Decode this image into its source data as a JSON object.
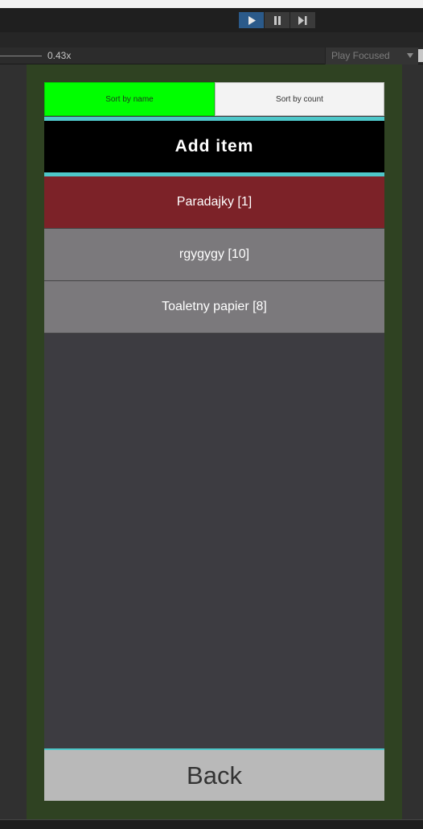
{
  "toolbar": {
    "play_icon": "play-icon",
    "pause_icon": "pause-icon",
    "step_icon": "step-icon"
  },
  "game_view": {
    "scale_label": "0.43x",
    "play_mode_label": "Play Focused"
  },
  "app": {
    "sort_by_name_label": "Sort by name",
    "sort_by_count_label": "Sort by count",
    "add_item_label": "Add item",
    "items": [
      {
        "label": "Paradajky [1]"
      },
      {
        "label": "rgygygy [10]"
      },
      {
        "label": "Toaletny papier [8]"
      }
    ],
    "back_label": "Back"
  },
  "colors": {
    "sort_active": "#00ff00",
    "accent_cyan": "#4ec7c9",
    "selected_item": "#7c2228",
    "normal_item": "#7b797c",
    "device_frame": "#2f4222"
  }
}
